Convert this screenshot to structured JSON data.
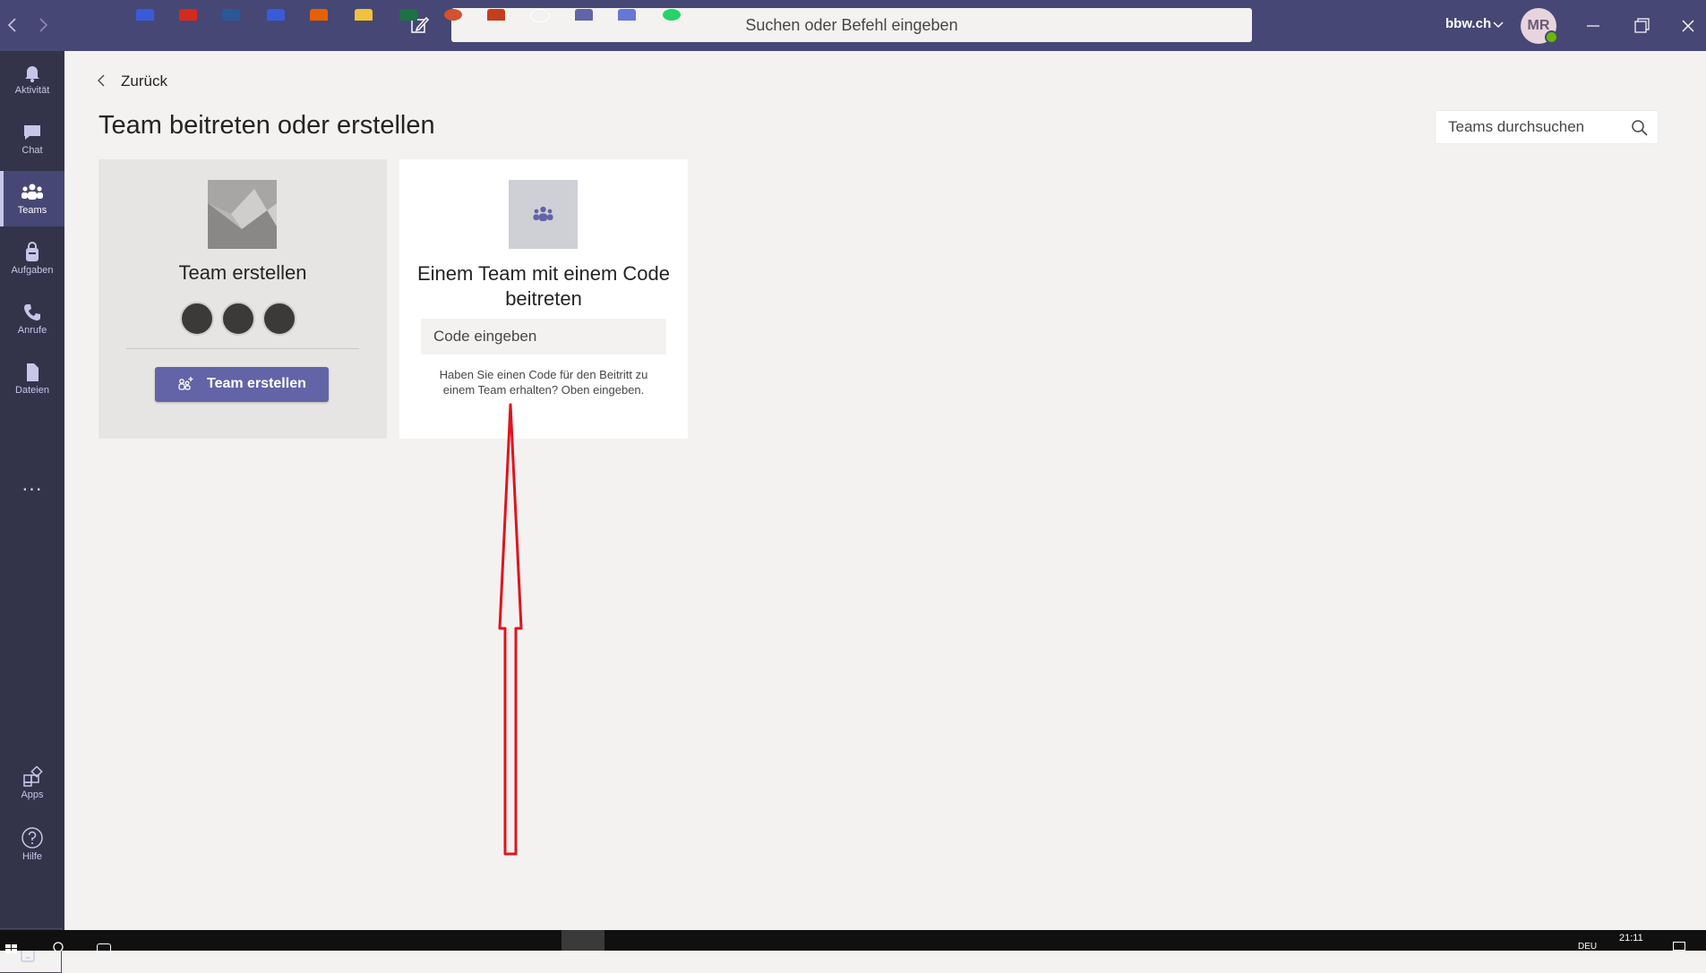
{
  "titlebar": {
    "search_placeholder": "Suchen oder Befehl eingeben",
    "tenant": "bbw.ch",
    "avatar_initials": "MR",
    "icons": [
      "back-arrow-icon",
      "forward-arrow-icon",
      "compose-icon",
      "chevron-down-icon",
      "minimize-icon",
      "restore-icon",
      "close-icon"
    ]
  },
  "rail": {
    "items": [
      {
        "label": "Aktivität",
        "icon": "bell-icon"
      },
      {
        "label": "Chat",
        "icon": "chat-icon"
      },
      {
        "label": "Teams",
        "icon": "teams-icon",
        "active": true
      },
      {
        "label": "Aufgaben",
        "icon": "tasks-icon"
      },
      {
        "label": "Anrufe",
        "icon": "phone-icon"
      },
      {
        "label": "Dateien",
        "icon": "files-icon"
      },
      {
        "label": "Apps",
        "icon": "apps-icon"
      },
      {
        "label": "Hilfe",
        "icon": "help-icon"
      }
    ],
    "more": "..."
  },
  "main": {
    "back_label": "Zurück",
    "title": "Team beitreten oder erstellen",
    "search_placeholder": "Teams durchsuchen",
    "create_card": {
      "title": "Team erstellen",
      "button_label": "Team erstellen"
    },
    "join_card": {
      "title": "Einem Team mit einem Code beitreten",
      "input_placeholder": "Code eingeben",
      "help_text": "Haben Sie einen Code für den Beitritt zu einem Team erhalten? Oben eingeben."
    }
  },
  "taskbar": {
    "time": "21:11",
    "lang": "DEU"
  },
  "colors": {
    "titlebar": "#464775",
    "rail": "#33344a",
    "accent": "#6264a7",
    "annotation": "#e0141e"
  }
}
